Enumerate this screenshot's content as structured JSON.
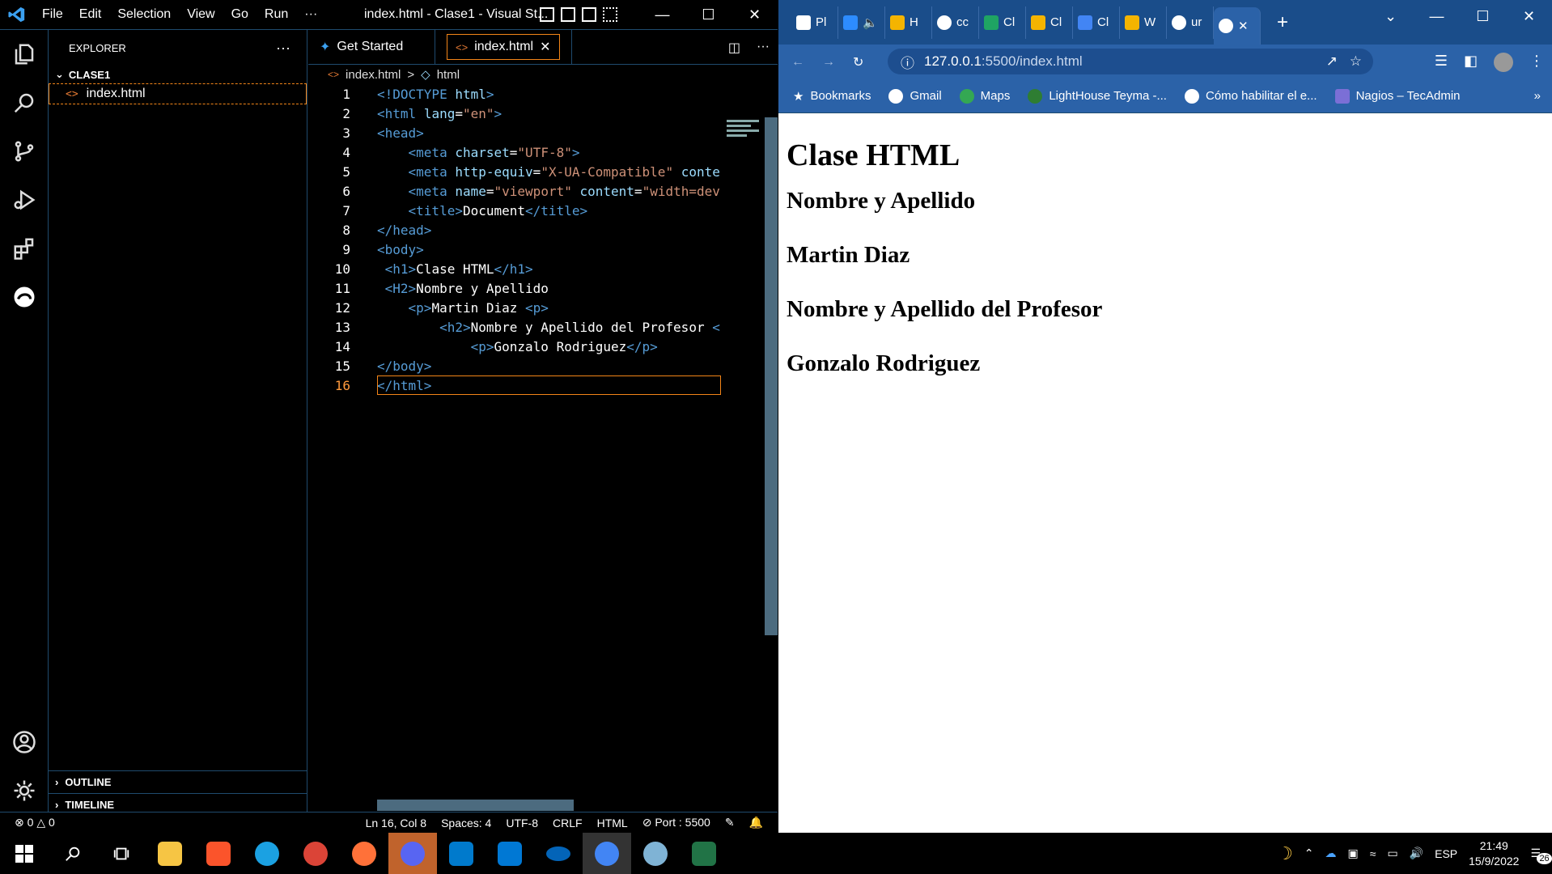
{
  "vscode": {
    "menu": [
      "File",
      "Edit",
      "Selection",
      "View",
      "Go",
      "Run",
      "···"
    ],
    "window_title": "index.html - Clase1 - Visual St...",
    "explorer_title": "EXPLORER",
    "folder": "CLASE1",
    "file": "index.html",
    "outline": "OUTLINE",
    "timeline": "TIMELINE",
    "tabs": [
      "Get Started",
      "index.html"
    ],
    "breadcrumb": [
      "index.html",
      ">",
      "html"
    ],
    "code_lines": [
      {
        "n": "1",
        "html": "<span class='tg'>&lt;!DOCTYPE</span> <span class='at'>html</span><span class='tg'>&gt;</span>"
      },
      {
        "n": "2",
        "html": "<span class='tg'>&lt;html</span> <span class='at'>lang</span>=<span class='st'>\"en\"</span><span class='tg'>&gt;</span>"
      },
      {
        "n": "3",
        "html": "<span class='tg'>&lt;head&gt;</span>"
      },
      {
        "n": "4",
        "html": "    <span class='tg'>&lt;meta</span> <span class='at'>charset</span>=<span class='st'>\"UTF-8\"</span><span class='tg'>&gt;</span>"
      },
      {
        "n": "5",
        "html": "    <span class='tg'>&lt;meta</span> <span class='at'>http-equiv</span>=<span class='st'>\"X-UA-Compatible\"</span> <span class='at'>conte</span>"
      },
      {
        "n": "6",
        "html": "    <span class='tg'>&lt;meta</span> <span class='at'>name</span>=<span class='st'>\"viewport\"</span> <span class='at'>content</span>=<span class='st'>\"width=dev</span>"
      },
      {
        "n": "7",
        "html": "    <span class='tg'>&lt;title&gt;</span>Document<span class='tg'>&lt;/title&gt;</span>"
      },
      {
        "n": "8",
        "html": "<span class='tg'>&lt;/head&gt;</span>"
      },
      {
        "n": "9",
        "html": "<span class='tg'>&lt;body&gt;</span>"
      },
      {
        "n": "10",
        "html": " <span class='tg'>&lt;h1&gt;</span>Clase HTML<span class='tg'>&lt;/h1&gt;</span>"
      },
      {
        "n": "11",
        "html": " <span class='tg'>&lt;H2&gt;</span>Nombre y Apellido"
      },
      {
        "n": "12",
        "html": "    <span class='tg'>&lt;p&gt;</span>Martin Diaz <span class='tg'>&lt;p&gt;</span>"
      },
      {
        "n": "13",
        "html": "        <span class='tg'>&lt;h2&gt;</span>Nombre y Apellido del Profesor <span class='tg'>&lt;</span>"
      },
      {
        "n": "14",
        "html": "            <span class='tg'>&lt;p&gt;</span>Gonzalo Rodriguez<span class='tg'>&lt;/p&gt;</span>"
      },
      {
        "n": "15",
        "html": "<span class='tg'>&lt;/body&gt;</span>"
      },
      {
        "n": "16",
        "html": "<span class='tg'>&lt;/html&gt;</span>"
      }
    ],
    "status": {
      "errors": "0",
      "warnings": "0",
      "position": "Ln 16, Col 8",
      "spaces": "Spaces: 4",
      "encoding": "UTF-8",
      "eol": "CRLF",
      "language": "HTML",
      "port": "Port : 5500"
    }
  },
  "browser": {
    "tabs": [
      "Pl",
      "H",
      "cc",
      "Cl",
      "Cl",
      "Cl",
      "W",
      "ur",
      ""
    ],
    "url_host": "127.0.0.1",
    "url_path": ":5500/index.html",
    "bookmarks": [
      "Bookmarks",
      "Gmail",
      "Maps",
      "LightHouse Teyma -...",
      "Cómo habilitar el e...",
      "Nagios – TecAdmin"
    ],
    "page": {
      "h1": "Clase HTML",
      "h2a": "Nombre y Apellido",
      "h2b": "Martin Diaz",
      "h2c": "Nombre y Apellido del Profesor",
      "h2d": "Gonzalo Rodriguez"
    }
  },
  "taskbar": {
    "lang": "ESP",
    "time": "21:49",
    "date": "15/9/2022",
    "notifications": "26"
  }
}
